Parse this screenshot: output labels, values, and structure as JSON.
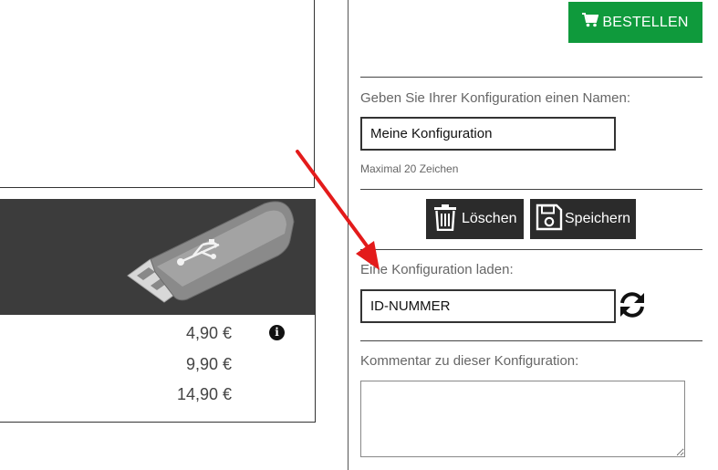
{
  "order_button": {
    "label": "BESTELLEN",
    "icon": "cart-icon"
  },
  "config_name": {
    "label": "Geben Sie Ihrer Konfiguration einen Namen:",
    "value": "Meine Konfiguration",
    "hint": "Maximal 20 Zeichen"
  },
  "actions": {
    "delete_label": "Löschen",
    "save_label": "Speichern"
  },
  "load_config": {
    "label": "Eine Konfiguration laden:",
    "value": "ID-NUMMER"
  },
  "comment": {
    "label": "Kommentar zu dieser Konfiguration:",
    "value": ""
  },
  "product": {
    "image": "usb-stick-image",
    "prices": [
      "4,90 €",
      "9,90 €",
      "14,90 €"
    ]
  },
  "colors": {
    "accent_green": "#0f9a3c",
    "dark_button": "#2b2b2b",
    "annotation_red": "#e31b1b"
  }
}
